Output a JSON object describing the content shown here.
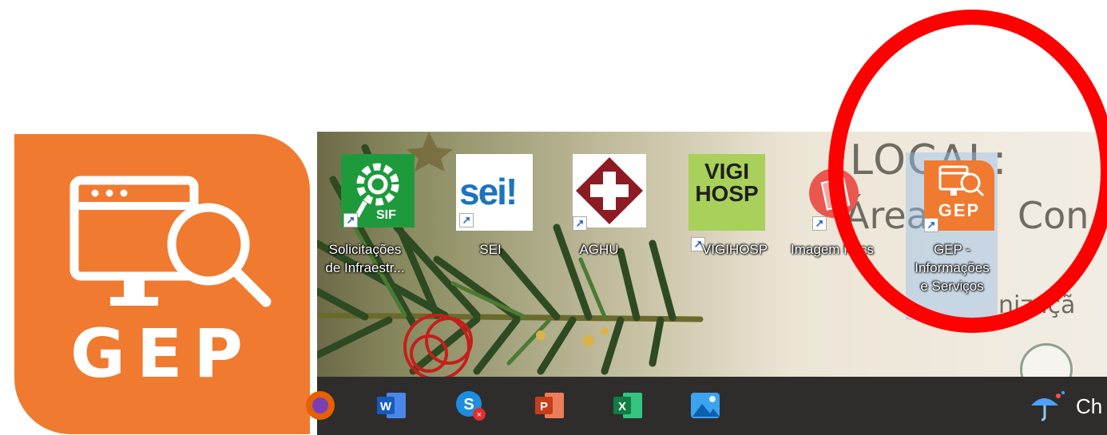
{
  "logo": {
    "text": "GEP",
    "color": "#f07a30",
    "icon": "monitor-search-icon"
  },
  "desktop": {
    "wallpaper_text": {
      "line1": "LOCAL:",
      "line2a": "Área",
      "line2b": "Con",
      "line3": "nizaçã"
    },
    "icons": [
      {
        "label_line1": "Solicitações",
        "label_line2": "de Infraestr...",
        "badge": "SIF",
        "icon": "sif-gear-icon"
      },
      {
        "label_line1": "SEI",
        "label_line2": "",
        "badge": "sei!",
        "icon": "sei-icon"
      },
      {
        "label_line1": "AGHU",
        "label_line2": "",
        "badge": "",
        "icon": "aghu-cross-icon"
      },
      {
        "label_line1": "VIGIHOSP",
        "label_line2": "",
        "badge": "VIGI HOSP",
        "badge_l1": "VIGI",
        "badge_l2": "HOSP",
        "icon": "vigihosp-icon"
      },
      {
        "label_line1": "Imagem Pacs",
        "label_line2": "",
        "badge": "",
        "icon": "pacs-image-icon"
      },
      {
        "label_line1": "GEP -",
        "label_line2": "Informações",
        "label_line3": "e Serviços",
        "badge": "GEP",
        "icon": "gep-icon"
      }
    ]
  },
  "taskbar": {
    "apps": [
      {
        "name": "firefox",
        "icon": "firefox-icon"
      },
      {
        "name": "word",
        "icon": "word-icon",
        "glyph": "W"
      },
      {
        "name": "skype",
        "icon": "skype-icon",
        "glyph": "S"
      },
      {
        "name": "powerpoint",
        "icon": "powerpoint-icon",
        "glyph": "P"
      },
      {
        "name": "excel",
        "icon": "excel-icon",
        "glyph": "X"
      },
      {
        "name": "photos",
        "icon": "photos-icon"
      }
    ],
    "weather_text": "Ch"
  },
  "colors": {
    "annotation": "#ff0000",
    "taskbar": "#2f2d2c",
    "gep_orange": "#f07a30"
  }
}
